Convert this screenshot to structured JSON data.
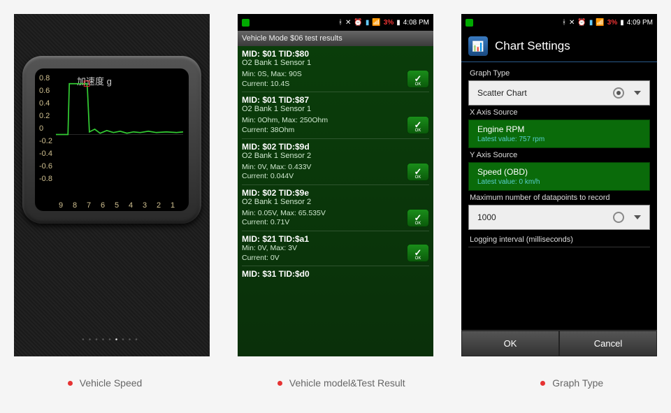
{
  "chart_data": {
    "type": "line",
    "title": "加速度 g",
    "xlabel": "",
    "ylabel": "",
    "x_ticks": [
      "9",
      "8",
      "7",
      "6",
      "5",
      "4",
      "3",
      "2",
      "1"
    ],
    "y_ticks": [
      "0.8",
      "0.6",
      "0.4",
      "0.2",
      "0",
      "-0.2",
      "-0.4",
      "-0.6",
      "-0.8"
    ],
    "ylim": [
      -0.9,
      0.9
    ],
    "series": [
      {
        "name": "acceleration",
        "values": [
          0.0,
          0.0,
          0.9,
          0.9,
          0.9,
          0.05,
          0.08,
          0.02,
          0.06,
          0.03,
          0.05,
          0.04,
          0.05,
          0.03,
          0.05,
          0.04,
          0.03,
          0.05
        ]
      }
    ]
  },
  "phone1": {
    "page_dots_total": 9,
    "page_dots_active": 6
  },
  "status": {
    "battery": "3%",
    "time2": "4:08 PM",
    "time3": "4:09 PM"
  },
  "phone2": {
    "header": "Vehicle Mode $06 test results",
    "tests": [
      {
        "mid": "MID: $01 TID:$80",
        "sensor": "O2 Bank 1 Sensor 1",
        "minmax": "Min: 0S, Max: 90S",
        "current": "Current: 10.4S"
      },
      {
        "mid": "MID: $01 TID:$87",
        "sensor": "O2 Bank 1 Sensor 1",
        "minmax": "Min: 0Ohm, Max: 250Ohm",
        "current": "Current: 38Ohm"
      },
      {
        "mid": "MID: $02 TID:$9d",
        "sensor": "O2 Bank 1 Sensor 2",
        "minmax": "Min: 0V, Max: 0.433V",
        "current": "Current: 0.044V"
      },
      {
        "mid": "MID: $02 TID:$9e",
        "sensor": "O2 Bank 1 Sensor 2",
        "minmax": "Min: 0.05V, Max: 65.535V",
        "current": "Current: 0.71V"
      },
      {
        "mid": "MID: $21 TID:$a1",
        "sensor": "",
        "minmax": "Min: 0V, Max: 3V",
        "current": "Current: 0V"
      },
      {
        "mid": "MID: $31 TID:$d0",
        "sensor": "",
        "minmax": "",
        "current": ""
      }
    ]
  },
  "phone3": {
    "title": "Chart Settings",
    "graph_type_label": "Graph Type",
    "graph_type_value": "Scatter Chart",
    "x_axis_label": "X Axis Source",
    "x_axis_value": "Engine RPM",
    "x_axis_latest": "Latest value: 757 rpm",
    "y_axis_label": "Y Axis Source",
    "y_axis_value": "Speed (OBD)",
    "y_axis_latest": "Latest value: 0 km/h",
    "max_datapoints_label": "Maximum number of datapoints to record",
    "max_datapoints_value": "1000",
    "logging_interval_label": "Logging interval (milliseconds)",
    "ok": "OK",
    "cancel": "Cancel"
  },
  "captions": {
    "c1": "Vehicle Speed",
    "c2": "Vehicle model&Test Result",
    "c3": "Graph Type"
  }
}
